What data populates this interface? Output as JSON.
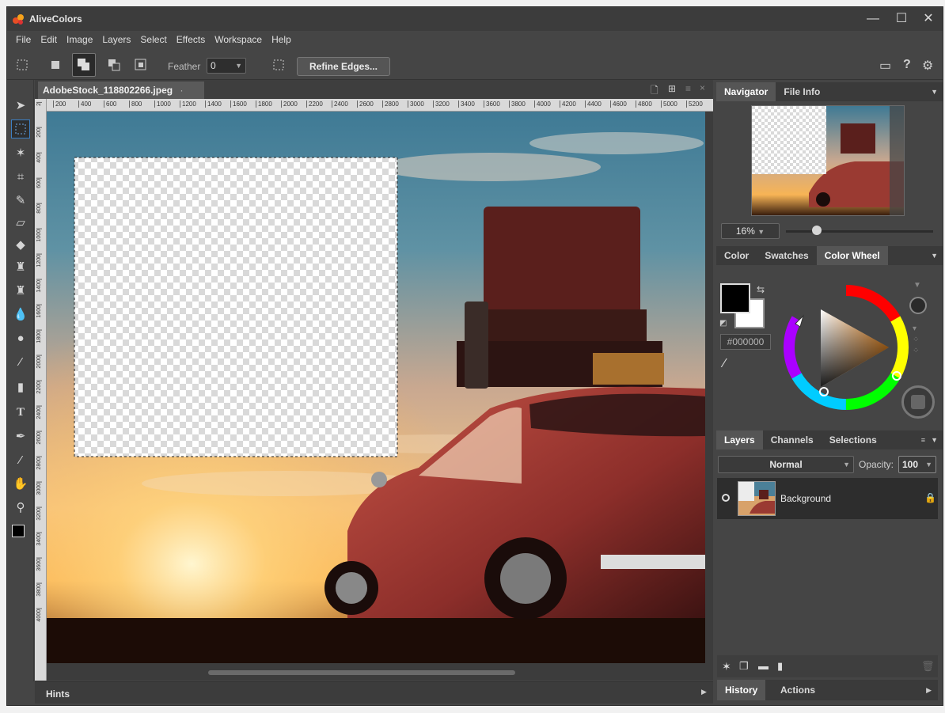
{
  "app": {
    "title": "AliveColors"
  },
  "window_controls": {
    "minimize": "—",
    "maximize": "☐",
    "close": "✕"
  },
  "menu": [
    "File",
    "Edit",
    "Image",
    "Layers",
    "Select",
    "Effects",
    "Workspace",
    "Help"
  ],
  "options": {
    "feather_label": "Feather",
    "feather_value": "0",
    "refine_label": "Refine Edges..."
  },
  "document": {
    "tab_label": "AdobeStock_118802266.jpeg",
    "ruler_h_ticks": [
      "200",
      "400",
      "600",
      "800",
      "1000",
      "1200",
      "1400",
      "1600",
      "1800",
      "2000",
      "2200",
      "2400",
      "2600",
      "2800",
      "3000",
      "3200",
      "3400",
      "3600",
      "3800",
      "4000",
      "4200",
      "4400",
      "4600",
      "4800",
      "5000",
      "5200"
    ],
    "ruler_v_ticks": [
      "2",
      "200",
      "400",
      "600",
      "800",
      "1000",
      "1200",
      "1400",
      "1600",
      "1800",
      "2000",
      "2200",
      "2400",
      "2600",
      "2800",
      "3000",
      "3200",
      "3400",
      "3600",
      "3800",
      "4000"
    ]
  },
  "hints": {
    "label": "Hints"
  },
  "navigator": {
    "tabs": [
      "Navigator",
      "File Info"
    ],
    "zoom": "16%",
    "zoom_level": 0.16
  },
  "color_panel": {
    "tabs": [
      "Color",
      "Swatches",
      "Color Wheel"
    ],
    "hex": "#000000",
    "foreground": "#000000",
    "background": "#ffffff"
  },
  "layers_panel": {
    "tabs": [
      "Layers",
      "Channels",
      "Selections"
    ],
    "blend_mode": "Normal",
    "opacity_label": "Opacity:",
    "opacity_value": "100",
    "layers": [
      {
        "name": "Background"
      }
    ]
  },
  "bottom_panel": {
    "tabs": [
      "History",
      "Actions"
    ]
  },
  "colors": {
    "accent": "#3b7fc4",
    "chrome": "#454545",
    "dark": "#2d2d2d"
  }
}
